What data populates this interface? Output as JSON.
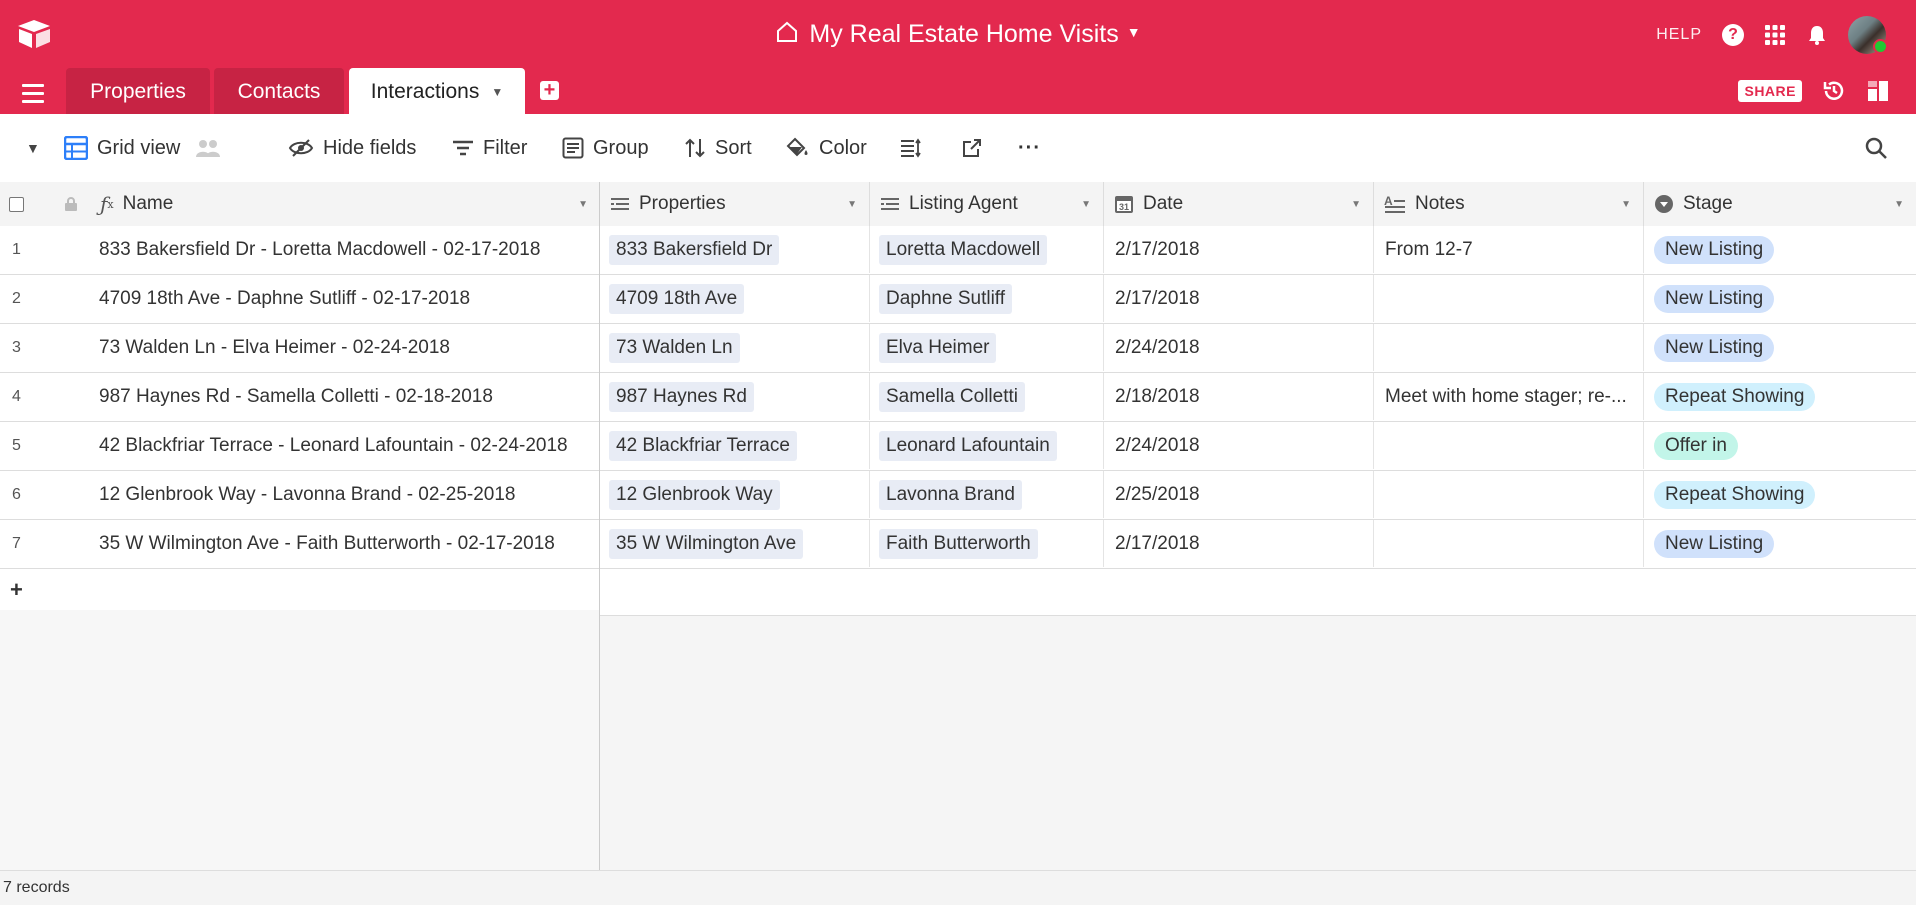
{
  "header": {
    "title": "My Real Estate Home Visits",
    "help": "HELP",
    "help_symbol": "?"
  },
  "tabs": [
    {
      "label": "Properties"
    },
    {
      "label": "Contacts"
    },
    {
      "label": "Interactions"
    }
  ],
  "share_label": "SHARE",
  "toolbar": {
    "view_name": "Grid view",
    "hide_fields": "Hide fields",
    "filter": "Filter",
    "group": "Group",
    "sort": "Sort",
    "color": "Color",
    "more": "···"
  },
  "columns": [
    {
      "label": "Name"
    },
    {
      "label": "Properties"
    },
    {
      "label": "Listing Agent"
    },
    {
      "label": "Date"
    },
    {
      "label": "Notes"
    },
    {
      "label": "Stage"
    }
  ],
  "rows": [
    {
      "num": "1",
      "name": "833 Bakersfield Dr - Loretta Macdowell - 02-17-2018",
      "property": "833 Bakersfield Dr",
      "agent": "Loretta Macdowell",
      "date": "2/17/2018",
      "notes": "From 12-7",
      "stage": "New Listing",
      "stage_color": "#d0e1fb"
    },
    {
      "num": "2",
      "name": "4709 18th Ave - Daphne Sutliff - 02-17-2018",
      "property": "4709 18th Ave",
      "agent": "Daphne Sutliff",
      "date": "2/17/2018",
      "notes": "",
      "stage": "New Listing",
      "stage_color": "#d0e1fb"
    },
    {
      "num": "3",
      "name": "73 Walden Ln - Elva Heimer - 02-24-2018",
      "property": "73 Walden Ln",
      "agent": "Elva Heimer",
      "date": "2/24/2018",
      "notes": "",
      "stage": "New Listing",
      "stage_color": "#d0e1fb"
    },
    {
      "num": "4",
      "name": "987 Haynes Rd - Samella Colletti - 02-18-2018",
      "property": "987 Haynes Rd",
      "agent": "Samella Colletti",
      "date": "2/18/2018",
      "notes": "Meet with home stager; re-...",
      "stage": "Repeat Showing",
      "stage_color": "#d0f0fd"
    },
    {
      "num": "5",
      "name": "42 Blackfriar Terrace - Leonard Lafountain - 02-24-2018",
      "property": "42 Blackfriar Terrace",
      "agent": "Leonard Lafountain",
      "date": "2/24/2018",
      "notes": "",
      "stage": "Offer in",
      "stage_color": "#c2f5e9"
    },
    {
      "num": "6",
      "name": "12 Glenbrook Way - Lavonna Brand - 02-25-2018",
      "property": "12 Glenbrook Way",
      "agent": "Lavonna Brand",
      "date": "2/25/2018",
      "notes": "",
      "stage": "Repeat Showing",
      "stage_color": "#d0f0fd"
    },
    {
      "num": "7",
      "name": "35 W Wilmington Ave - Faith Butterworth - 02-17-2018",
      "property": "35 W Wilmington Ave",
      "agent": "Faith Butterworth",
      "date": "2/17/2018",
      "notes": "",
      "stage": "New Listing",
      "stage_color": "#d0e1fb"
    }
  ],
  "add_row": "+",
  "footer": {
    "records": "7 records"
  },
  "colors": {
    "brand": "#e3294e",
    "tab_inactive": "#c72344",
    "grid_icon": "#2d7ff9"
  },
  "icons": [
    "logo-icon",
    "home-icon",
    "help-icon",
    "apps-icon",
    "bell-icon",
    "hamburger-icon",
    "add-table-icon",
    "history-icon",
    "blocks-icon",
    "grid-view-icon",
    "people-icon",
    "hide-fields-icon",
    "filter-icon",
    "group-icon",
    "sort-icon",
    "color-icon",
    "row-height-icon",
    "share-view-icon",
    "more-icon",
    "search-icon",
    "formula-icon",
    "link-icon",
    "calendar-icon",
    "long-text-icon",
    "single-select-icon",
    "lock-icon"
  ]
}
